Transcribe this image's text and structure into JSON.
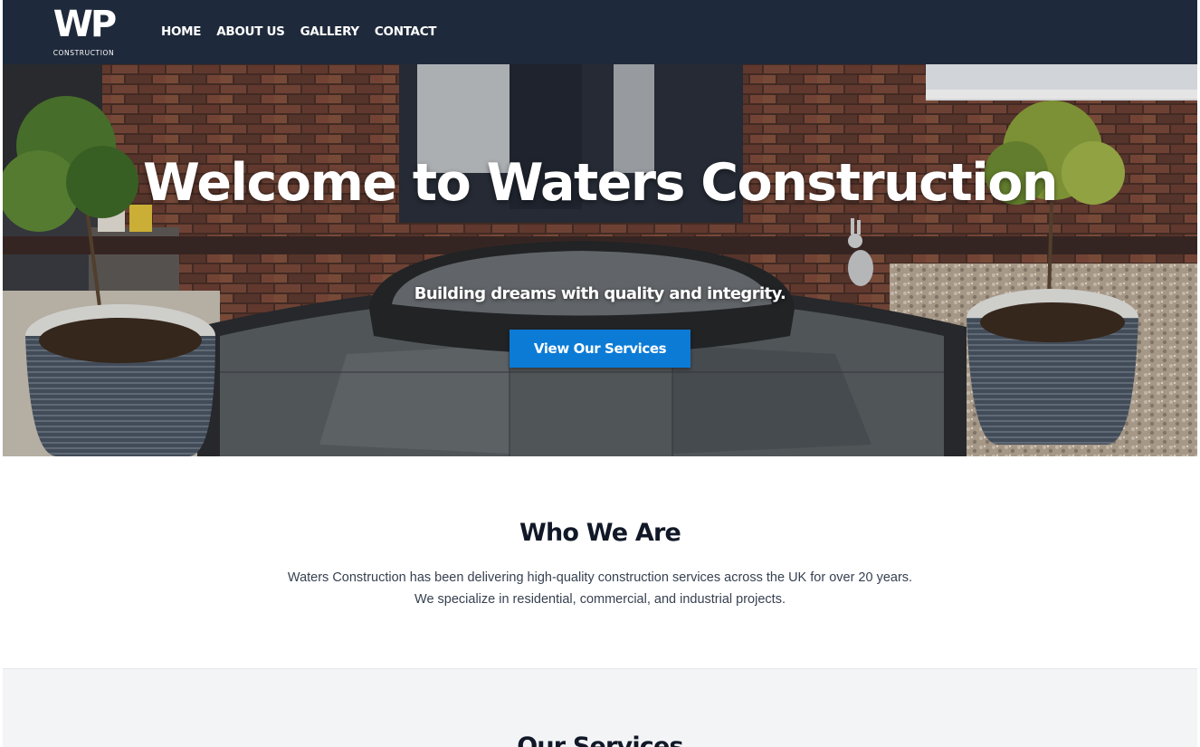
{
  "brand": {
    "logo_mark": "WP",
    "logo_sub": "CONSTRUCTION"
  },
  "nav": {
    "items": [
      "HOME",
      "ABOUT US",
      "GALLERY",
      "CONTACT"
    ]
  },
  "hero": {
    "title": "Welcome to Waters Construction",
    "subtitle": "Building dreams with quality and integrity.",
    "cta_label": "View Our Services",
    "background_image": "brick-house-front-step-patio-with-potted-trees"
  },
  "about": {
    "title": "Who We Are",
    "text": "Waters Construction has been delivering high-quality construction services across the UK for over 20 years. We specialize in residential, commercial, and industrial projects."
  },
  "services": {
    "title": "Our Services"
  },
  "colors": {
    "nav_bg": "#1e293b",
    "accent": "#0b7bd6",
    "section_alt_bg": "#f3f4f6"
  }
}
